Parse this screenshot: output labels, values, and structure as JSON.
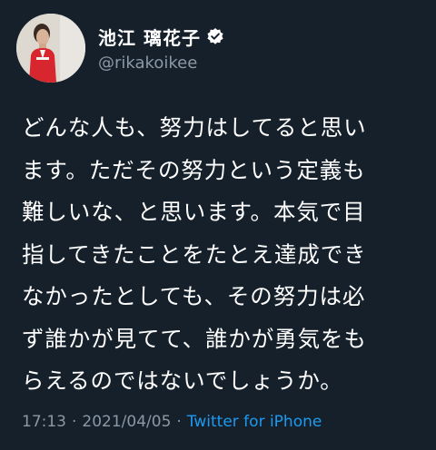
{
  "author": {
    "display_name": "池江 璃花子",
    "handle": "@rikakoikee",
    "verified": true
  },
  "tweet": {
    "text": "どんな人も、努力はしてると思い\nます。ただその努力という定義も\n難しいな、と思います。本気で目\n指してきたことをたとえ達成でき\nなかったとしても、その努力は必\nず誰かが見てて、誰かが勇気をも\nらえるのではないでしょうか。",
    "time": "17:13",
    "date": "2021/04/05",
    "separator": "·",
    "source": "Twitter for iPhone"
  },
  "colors": {
    "background": "#15202b",
    "text": "#ffffff",
    "secondary": "#8b98a5",
    "accent": "#1d9bf0"
  }
}
